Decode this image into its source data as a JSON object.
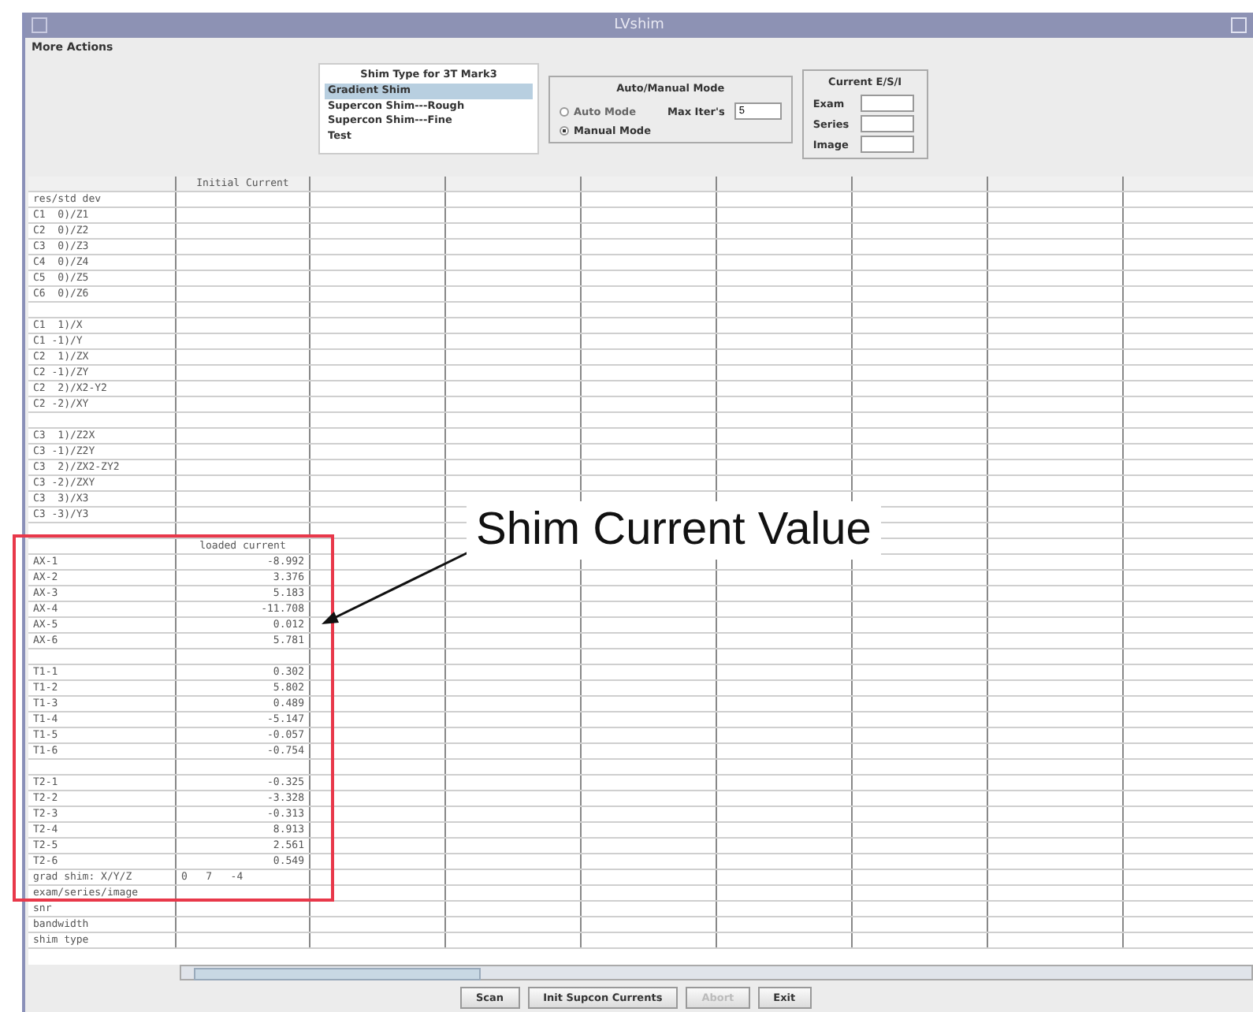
{
  "window": {
    "title": "LVshim"
  },
  "menu": [
    "More Actions"
  ],
  "shim_type": {
    "title": "Shim Type for 3T Mark3",
    "items": [
      {
        "label": "Gradient Shim",
        "selected": true
      },
      {
        "label": "Supercon Shim---Rough",
        "selected": false
      },
      {
        "label": "Supercon Shim---Fine",
        "selected": false
      },
      {
        "label": "Test",
        "selected": false
      }
    ]
  },
  "mode": {
    "title": "Auto/Manual Mode",
    "options": [
      {
        "label": "Auto Mode",
        "selected": false
      },
      {
        "label": "Manual Mode",
        "selected": true
      }
    ],
    "max_iters": {
      "label": "Max Iter's",
      "value": "5"
    }
  },
  "current": {
    "title": "Current E/S/I",
    "fields": [
      {
        "label": "Exam"
      },
      {
        "label": "Series"
      },
      {
        "label": "Image"
      }
    ]
  },
  "table": {
    "header": "Initial Current",
    "rows": [
      {
        "kind": "label",
        "label": "res/std dev"
      },
      {
        "kind": "label",
        "label": "C1  0)/Z1"
      },
      {
        "kind": "label",
        "label": "C2  0)/Z2"
      },
      {
        "kind": "label",
        "label": "C3  0)/Z3"
      },
      {
        "kind": "label",
        "label": "C4  0)/Z4"
      },
      {
        "kind": "label",
        "label": "C5  0)/Z5"
      },
      {
        "kind": "label",
        "label": "C6  0)/Z6"
      },
      {
        "kind": "blank"
      },
      {
        "kind": "label",
        "label": "C1  1)/X"
      },
      {
        "kind": "label",
        "label": "C1 -1)/Y"
      },
      {
        "kind": "label",
        "label": "C2  1)/ZX"
      },
      {
        "kind": "label",
        "label": "C2 -1)/ZY"
      },
      {
        "kind": "label",
        "label": "C2  2)/X2-Y2"
      },
      {
        "kind": "label",
        "label": "C2 -2)/XY"
      },
      {
        "kind": "blank"
      },
      {
        "kind": "label",
        "label": "C3  1)/Z2X"
      },
      {
        "kind": "label",
        "label": "C3 -1)/Z2Y"
      },
      {
        "kind": "label",
        "label": "C3  2)/ZX2-ZY2"
      },
      {
        "kind": "label",
        "label": "C3 -2)/ZXY"
      },
      {
        "kind": "label",
        "label": "C3  3)/X3"
      },
      {
        "kind": "label",
        "label": "C3 -3)/Y3"
      },
      {
        "kind": "blank"
      },
      {
        "kind": "subheader",
        "value": "loaded current"
      },
      {
        "kind": "value",
        "label": "AX-1",
        "value": "-8.992"
      },
      {
        "kind": "value",
        "label": "AX-2",
        "value": "3.376"
      },
      {
        "kind": "value",
        "label": "AX-3",
        "value": "5.183"
      },
      {
        "kind": "value",
        "label": "AX-4",
        "value": "-11.708"
      },
      {
        "kind": "value",
        "label": "AX-5",
        "value": "0.012"
      },
      {
        "kind": "value",
        "label": "AX-6",
        "value": "5.781"
      },
      {
        "kind": "blank"
      },
      {
        "kind": "value",
        "label": "T1-1",
        "value": "0.302"
      },
      {
        "kind": "value",
        "label": "T1-2",
        "value": "5.802"
      },
      {
        "kind": "value",
        "label": "T1-3",
        "value": "0.489"
      },
      {
        "kind": "value",
        "label": "T1-4",
        "value": "-5.147"
      },
      {
        "kind": "value",
        "label": "T1-5",
        "value": "-0.057"
      },
      {
        "kind": "value",
        "label": "T1-6",
        "value": "-0.754"
      },
      {
        "kind": "blank"
      },
      {
        "kind": "value",
        "label": "T2-1",
        "value": "-0.325"
      },
      {
        "kind": "value",
        "label": "T2-2",
        "value": "-3.328"
      },
      {
        "kind": "value",
        "label": "T2-3",
        "value": "-0.313"
      },
      {
        "kind": "value",
        "label": "T2-4",
        "value": "8.913"
      },
      {
        "kind": "value",
        "label": "T2-5",
        "value": "2.561"
      },
      {
        "kind": "value",
        "label": "T2-6",
        "value": "0.549"
      },
      {
        "kind": "value",
        "label": "grad shim: X/Y/Z",
        "value": "0   7   -4"
      },
      {
        "kind": "label",
        "label": "exam/series/image"
      },
      {
        "kind": "label",
        "label": "snr"
      },
      {
        "kind": "label",
        "label": "bandwidth"
      },
      {
        "kind": "label",
        "label": "shim type"
      }
    ]
  },
  "buttons": [
    {
      "label": "Scan",
      "disabled": false
    },
    {
      "label": "Init Supcon Currents",
      "disabled": false
    },
    {
      "label": "Abort",
      "disabled": true
    },
    {
      "label": "Exit",
      "disabled": false
    }
  ],
  "annotation": {
    "text": "Shim Current Value"
  }
}
